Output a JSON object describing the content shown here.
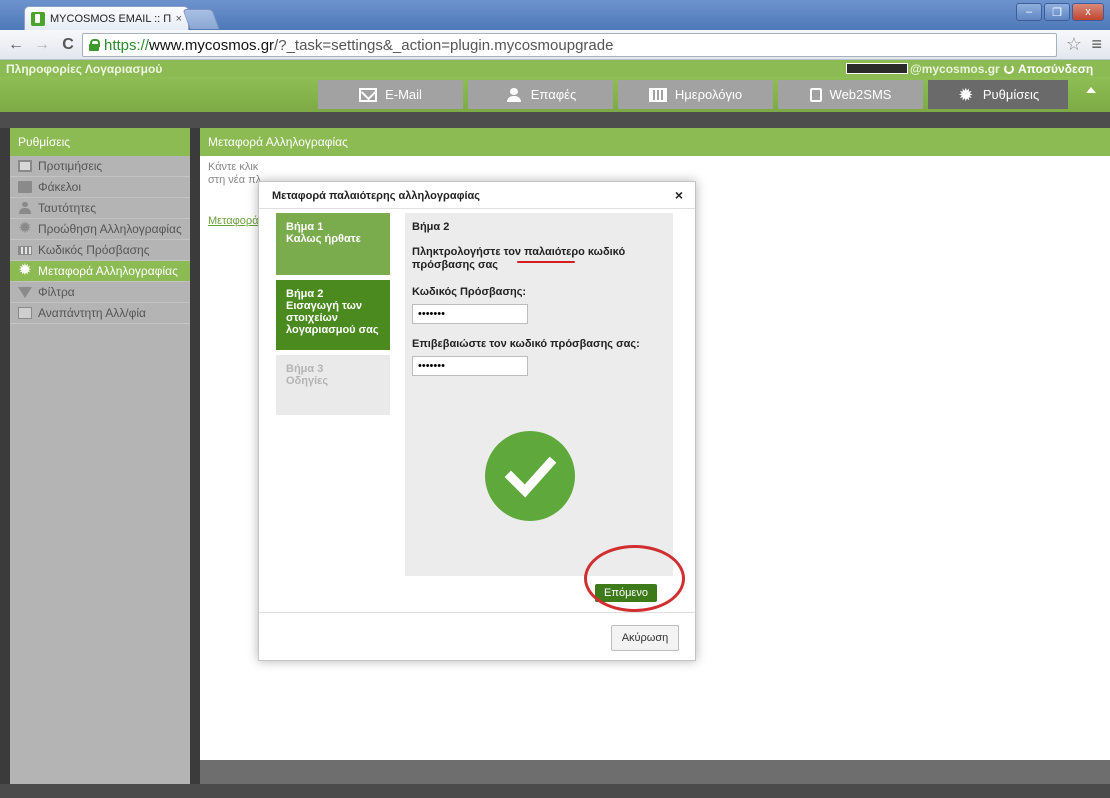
{
  "browser": {
    "tab_title": "MYCOSMOS EMAIL :: Προτιμ",
    "tab_close": "×",
    "url_scheme": "https://",
    "url_host": "www.mycosmos.gr",
    "url_path": "/?_task=settings&_action=plugin.mycosmoupgrade",
    "back_glyph": "←",
    "forward_glyph": "→",
    "reload_glyph": "C",
    "star_glyph": "☆",
    "menu_glyph": "≡",
    "window_buttons": [
      "–",
      "❐",
      "x"
    ]
  },
  "appbar": {
    "account_info": "Πληροφορίες Λογαριασμού",
    "user_email_suffix": "@mycosmos.gr",
    "logout": "Αποσύνδεση"
  },
  "navbar": {
    "tabs": [
      {
        "label": "E-Mail",
        "icon": "mail-icon"
      },
      {
        "label": "Επαφές",
        "icon": "contacts-icon"
      },
      {
        "label": "Ημερολόγιο",
        "icon": "calendar-icon"
      },
      {
        "label": "Web2SMS",
        "icon": "sms-icon"
      },
      {
        "label": "Ρυθμίσεις",
        "icon": "gear-icon",
        "active": true
      }
    ]
  },
  "sidebar": {
    "title": "Ρυθμίσεις",
    "items": [
      {
        "label": "Προτιμήσεις",
        "icon": "monitor-icon"
      },
      {
        "label": "Φάκελοι",
        "icon": "folder-icon"
      },
      {
        "label": "Ταυτότητες",
        "icon": "identity-icon"
      },
      {
        "label": "Προώθηση Αλληλογραφίας",
        "icon": "gear-icon"
      },
      {
        "label": "Κωδικός Πρόσβασης",
        "icon": "password-icon"
      },
      {
        "label": "Μεταφορά Αλληλογραφίας",
        "icon": "gear-icon",
        "active": true
      },
      {
        "label": "Φίλτρα",
        "icon": "filter-icon"
      },
      {
        "label": "Αναπάντητη Αλλ/φία",
        "icon": "autoreply-icon"
      }
    ]
  },
  "main": {
    "title": "Μεταφορά Αλληλογραφίας",
    "text_line1": "Κάντε κλικ",
    "text_line2": "στη νέα πλ",
    "link": "Μεταφορά"
  },
  "modal": {
    "title": "Μεταφορά παλαιότερης αλληλογραφίας",
    "close": "×",
    "steps": [
      {
        "line1": "Βήμα 1",
        "line2": "Καλως ήρθατε"
      },
      {
        "line1": "Βήμα 2",
        "line2": "Εισαγωγή των στοιχείων λογαριασμού σας"
      },
      {
        "line1": "Βήμα 3",
        "line2": "Οδηγίες"
      }
    ],
    "form_step": "Βήμα 2",
    "instruction": "Πληκτρολογήστε τον παλαιότερο κωδικό πρόσβασης σας",
    "password_label": "Κωδικός Πρόσβασης:",
    "password_value": "•••••••",
    "confirm_label": "Επιβεβαιώστε τον κωδικό πρόσβασης σας:",
    "confirm_value": "•••••••",
    "next_button": "Επόμενο",
    "cancel_button": "Ακύρωση"
  },
  "colors": {
    "brand_green": "#8cba53",
    "step_active": "#4a8a1e",
    "annotation_red": "#d12f2f"
  }
}
